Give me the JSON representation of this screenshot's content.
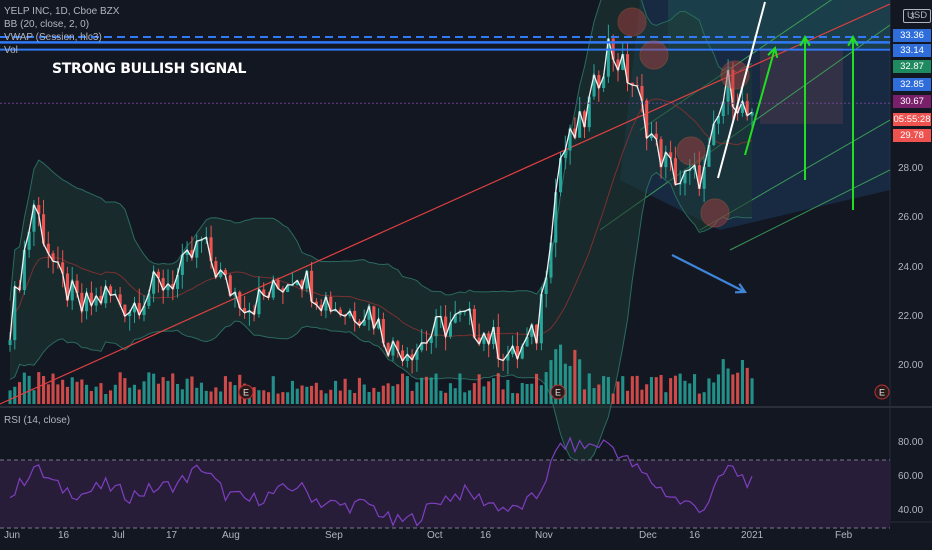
{
  "legend": {
    "symbol": "YELP INC, 1D, Cboe BZX",
    "bb": "BB (20, close, 2, 0)",
    "vwap": "VWAP (Session, hlc3)",
    "vol": "Vol",
    "rsi": "RSI (14, close)"
  },
  "annotation": "STRONG BULLISH SIGNAL",
  "axis_unit": "USD",
  "axis_top_partial": "3",
  "colors": {
    "background": "#131722",
    "up": "#26a69a",
    "down": "#ef5350",
    "price_line": "#f0f0f0",
    "bollinger": "#2a6b5e",
    "bollinger_fill": "#1e3a35",
    "rsi_line": "#7e3fbf",
    "rsi_band": "#2a1e3c",
    "blue_level": "#2962ff",
    "arrow_green": "#22dd22",
    "arrow_blue": "#3f86d9",
    "trend_red": "#e04040"
  },
  "price_tags": [
    {
      "label": "33.36",
      "bg": "#2f6dda"
    },
    {
      "label": "33.14",
      "bg": "#2f6dda"
    },
    {
      "label": "32.87",
      "bg": "#1f8a5f"
    },
    {
      "label": "32.85",
      "bg": "#2f6dda"
    },
    {
      "label": "30.67",
      "bg": "#7a1f6a"
    },
    {
      "label": "05:55:28",
      "bg": "#ef5350"
    },
    {
      "label": "29.78",
      "bg": "#ef5350"
    }
  ],
  "earnings_marker": "E",
  "chart_data": [
    {
      "type": "candlestick",
      "title": "YELP INC, 1D, Cboe BZX",
      "y_axis": {
        "unit": "USD",
        "ticks": [
          20,
          22,
          24,
          26,
          28
        ],
        "tick_labels": [
          "20.00",
          "22.00",
          "24.00",
          "26.00",
          "28.00"
        ],
        "ylim": [
          19,
          34
        ]
      },
      "x_axis": {
        "tick_labels": [
          "Jun",
          "16",
          "Jul",
          "17",
          "Aug",
          "Sep",
          "Oct",
          "16",
          "Nov",
          "Dec",
          "16",
          "2021",
          "Feb"
        ]
      },
      "close_series": [
        {
          "date": "2020-06-01",
          "close": 21.7
        },
        {
          "date": "2020-06-08",
          "close": 26.6
        },
        {
          "date": "2020-06-15",
          "close": 23.6
        },
        {
          "date": "2020-06-22",
          "close": 22.3
        },
        {
          "date": "2020-06-29",
          "close": 22.9
        },
        {
          "date": "2020-07-06",
          "close": 22.4
        },
        {
          "date": "2020-07-13",
          "close": 23.2
        },
        {
          "date": "2020-07-20",
          "close": 23.6
        },
        {
          "date": "2020-07-27",
          "close": 25.0
        },
        {
          "date": "2020-08-03",
          "close": 23.3
        },
        {
          "date": "2020-08-10",
          "close": 22.5
        },
        {
          "date": "2020-08-17",
          "close": 23.0
        },
        {
          "date": "2020-08-24",
          "close": 23.9
        },
        {
          "date": "2020-08-31",
          "close": 22.8
        },
        {
          "date": "2020-09-08",
          "close": 22.2
        },
        {
          "date": "2020-09-14",
          "close": 22.3
        },
        {
          "date": "2020-09-21",
          "close": 20.7
        },
        {
          "date": "2020-09-28",
          "close": 20.8
        },
        {
          "date": "2020-10-05",
          "close": 21.6
        },
        {
          "date": "2020-10-12",
          "close": 21.9
        },
        {
          "date": "2020-10-19",
          "close": 21.2
        },
        {
          "date": "2020-10-26",
          "close": 20.3
        },
        {
          "date": "2020-11-02",
          "close": 21.3
        },
        {
          "date": "2020-11-09",
          "close": 28.5
        },
        {
          "date": "2020-11-16",
          "close": 30.0
        },
        {
          "date": "2020-11-23",
          "close": 33.0
        },
        {
          "date": "2020-11-30",
          "close": 31.5
        },
        {
          "date": "2020-12-07",
          "close": 28.8
        },
        {
          "date": "2020-12-14",
          "close": 27.5
        },
        {
          "date": "2020-12-21",
          "close": 27.8
        },
        {
          "date": "2020-12-28",
          "close": 31.5
        },
        {
          "date": "2021-01-04",
          "close": 29.8
        }
      ],
      "price_levels": [
        33.36,
        33.14,
        32.87,
        32.85,
        30.67,
        29.78
      ],
      "volume_shown": true
    },
    {
      "type": "line",
      "title": "RSI (14, close)",
      "y_axis": {
        "ticks": [
          40,
          60,
          80
        ],
        "tick_labels": [
          "40.00",
          "60.00",
          "80.00"
        ],
        "ylim": [
          30,
          85
        ]
      },
      "bands": [
        30,
        70
      ],
      "series": [
        {
          "date": "2020-06-01",
          "value": 48
        },
        {
          "date": "2020-06-08",
          "value": 66
        },
        {
          "date": "2020-06-15",
          "value": 54
        },
        {
          "date": "2020-06-22",
          "value": 50
        },
        {
          "date": "2020-06-29",
          "value": 55
        },
        {
          "date": "2020-07-06",
          "value": 49
        },
        {
          "date": "2020-07-13",
          "value": 53
        },
        {
          "date": "2020-07-20",
          "value": 56
        },
        {
          "date": "2020-07-27",
          "value": 66
        },
        {
          "date": "2020-08-03",
          "value": 50
        },
        {
          "date": "2020-08-10",
          "value": 46
        },
        {
          "date": "2020-08-17",
          "value": 50
        },
        {
          "date": "2020-08-24",
          "value": 55
        },
        {
          "date": "2020-08-31",
          "value": 45
        },
        {
          "date": "2020-09-08",
          "value": 43
        },
        {
          "date": "2020-09-14",
          "value": 44
        },
        {
          "date": "2020-09-21",
          "value": 33
        },
        {
          "date": "2020-09-28",
          "value": 36
        },
        {
          "date": "2020-10-05",
          "value": 47
        },
        {
          "date": "2020-10-12",
          "value": 51
        },
        {
          "date": "2020-10-19",
          "value": 45
        },
        {
          "date": "2020-10-26",
          "value": 40
        },
        {
          "date": "2020-11-02",
          "value": 48
        },
        {
          "date": "2020-11-09",
          "value": 79
        },
        {
          "date": "2020-11-16",
          "value": 78
        },
        {
          "date": "2020-11-23",
          "value": 80
        },
        {
          "date": "2020-11-30",
          "value": 67
        },
        {
          "date": "2020-12-07",
          "value": 55
        },
        {
          "date": "2020-12-14",
          "value": 45
        },
        {
          "date": "2020-12-21",
          "value": 42
        },
        {
          "date": "2020-12-28",
          "value": 66
        },
        {
          "date": "2021-01-04",
          "value": 56
        }
      ]
    }
  ]
}
